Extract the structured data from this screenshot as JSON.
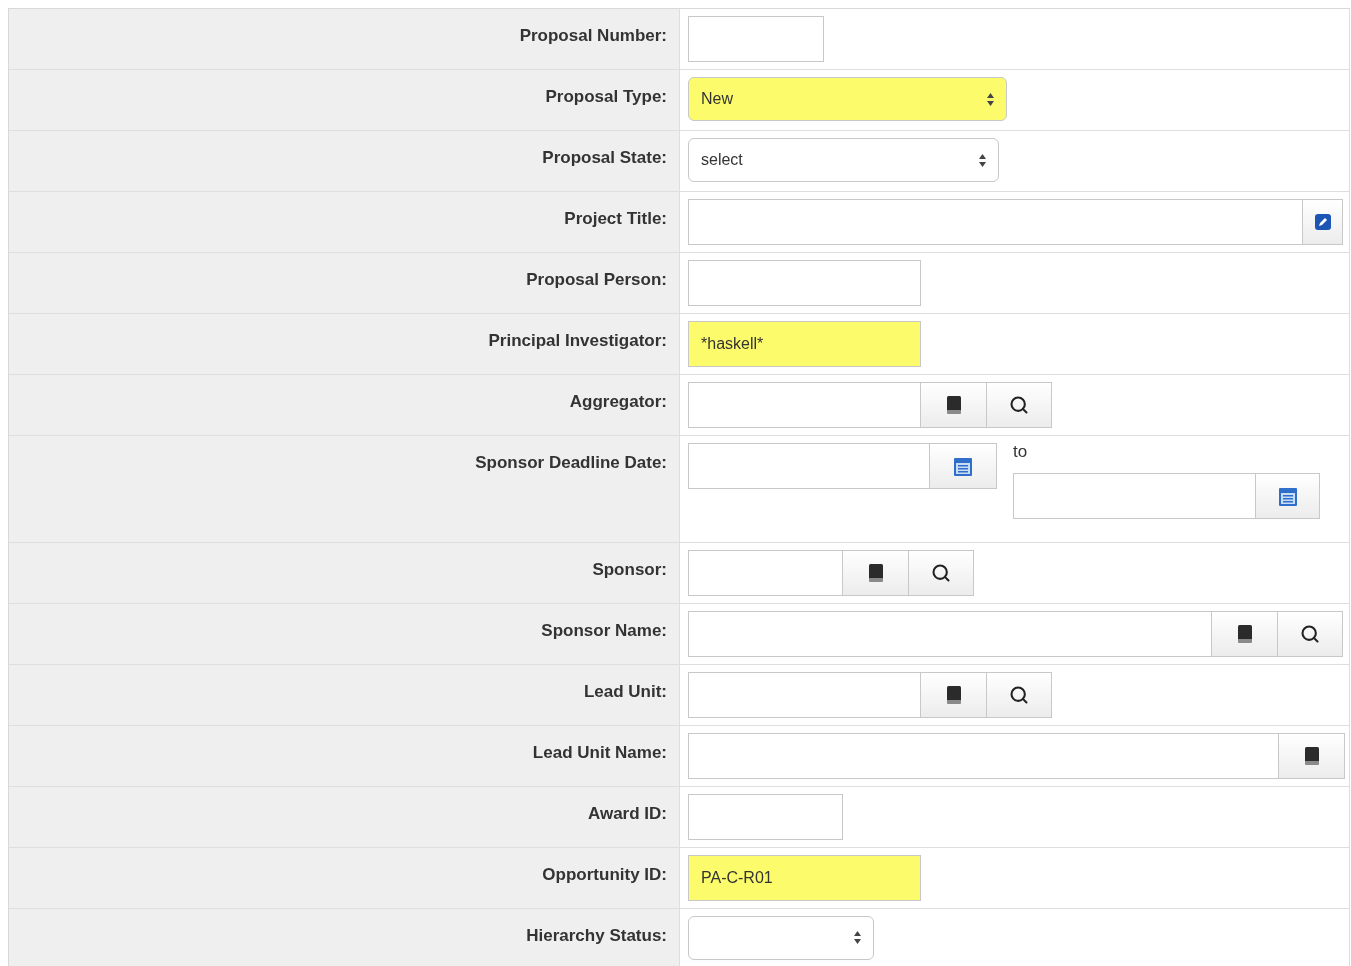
{
  "rows": [
    {
      "label": "Proposal Number:",
      "field": {
        "kind": "text",
        "highlighted": false
      }
    },
    {
      "label": "Proposal Type:",
      "field": {
        "kind": "select",
        "value": "New",
        "highlighted": true
      }
    },
    {
      "label": "Proposal State:",
      "field": {
        "kind": "select",
        "value": "select",
        "highlighted": false
      }
    },
    {
      "label": "Project Title:",
      "field": {
        "kind": "textarea",
        "highlighted": false
      }
    },
    {
      "label": "Proposal Person:",
      "field": {
        "kind": "text",
        "highlighted": false
      }
    },
    {
      "label": "Principal Investigator:",
      "field": {
        "kind": "text",
        "value": "*haskell*",
        "highlighted": true
      }
    },
    {
      "label": "Aggregator:",
      "field": {
        "kind": "lookup",
        "highlighted": false
      }
    },
    {
      "label": "Sponsor Deadline Date:",
      "field": {
        "kind": "date-range",
        "separator": "to",
        "highlighted": false
      }
    },
    {
      "label": "Sponsor:",
      "field": {
        "kind": "lookup",
        "highlighted": false
      }
    },
    {
      "label": "Sponsor Name:",
      "field": {
        "kind": "lookup",
        "highlighted": false
      }
    },
    {
      "label": "Lead Unit:",
      "field": {
        "kind": "lookup",
        "highlighted": false
      }
    },
    {
      "label": "Lead Unit Name:",
      "field": {
        "kind": "book",
        "highlighted": false
      }
    },
    {
      "label": "Award ID:",
      "field": {
        "kind": "text",
        "highlighted": false
      }
    },
    {
      "label": "Opportunity ID:",
      "field": {
        "kind": "text",
        "value": "PA-C-R01",
        "highlighted": true
      }
    },
    {
      "label": "Hierarchy Status:",
      "field": {
        "kind": "select",
        "highlighted": false
      }
    }
  ]
}
